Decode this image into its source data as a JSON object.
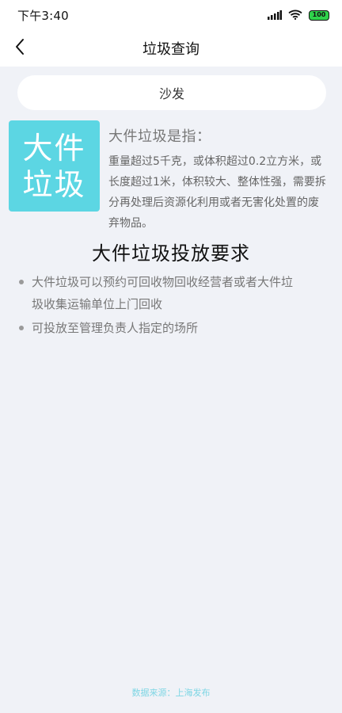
{
  "status_bar": {
    "time": "下午3:40",
    "battery": "100",
    "icons": [
      "signal-icon",
      "wifi-icon",
      "battery-icon"
    ]
  },
  "nav": {
    "back_icon": "chevron-left-icon",
    "title": "垃圾查询"
  },
  "search": {
    "query": "沙发"
  },
  "category": {
    "tile_line1": "大件",
    "tile_line2": "垃圾",
    "tile_color": "#5cd6e3",
    "definition_title": "大件垃圾是指：",
    "definition_text": "重量超过5千克，或体积超过0.2立方米，或长度超过1米，体积较大、整体性强，需要拆分再处理后资源化利用或者无害化处置的废弃物品。"
  },
  "requirements": {
    "title": "大件垃圾投放要求",
    "items": [
      "大件垃圾可以预约可回收物回收经营者或者大件垃圾收集运输单位上门回收",
      "可投放至管理负责人指定的场所"
    ]
  },
  "footer": {
    "source": "数据来源：上海发布"
  }
}
